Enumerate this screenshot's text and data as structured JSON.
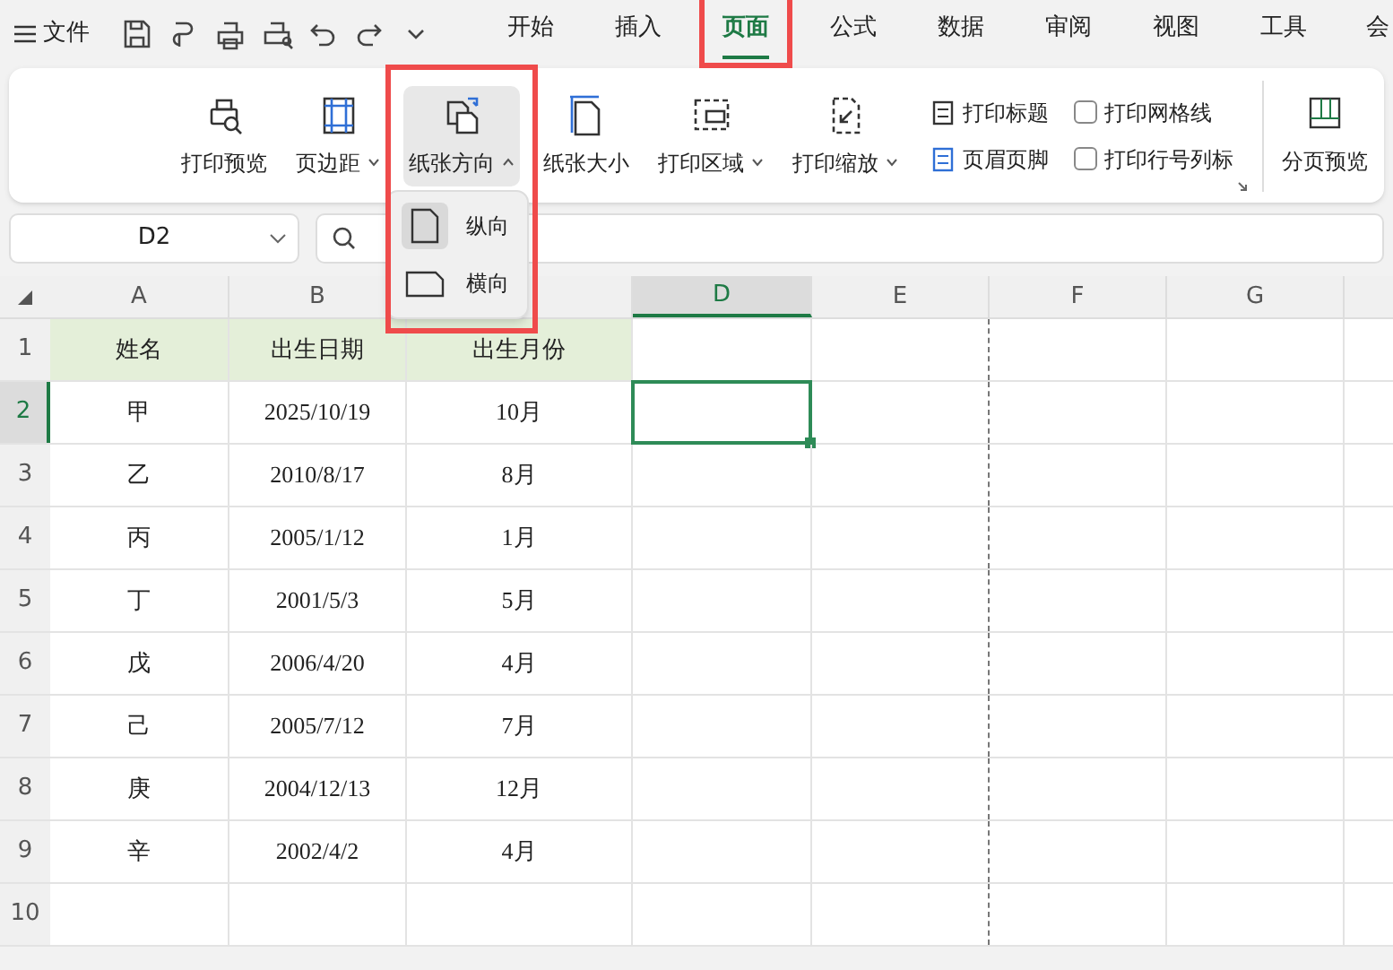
{
  "menu": {
    "label": "文件"
  },
  "tabs": [
    {
      "label": "开始",
      "selected": false,
      "highlighted": false
    },
    {
      "label": "插入",
      "selected": false,
      "highlighted": false
    },
    {
      "label": "页面",
      "selected": true,
      "highlighted": true
    },
    {
      "label": "公式",
      "selected": false,
      "highlighted": false
    },
    {
      "label": "数据",
      "selected": false,
      "highlighted": false
    },
    {
      "label": "审阅",
      "selected": false,
      "highlighted": false
    },
    {
      "label": "视图",
      "selected": false,
      "highlighted": false
    },
    {
      "label": "工具",
      "selected": false,
      "highlighted": false
    },
    {
      "label": "会",
      "selected": false,
      "highlighted": false
    }
  ],
  "ribbon": {
    "large_buttons": [
      {
        "kind": "preview",
        "label": "打印预览",
        "has_menu": false,
        "expanded": false,
        "highlighted": false
      },
      {
        "kind": "margins",
        "label": "页边距",
        "has_menu": true,
        "expanded": false,
        "highlighted": false
      },
      {
        "kind": "orientation",
        "label": "纸张方向",
        "has_menu": true,
        "expanded": true,
        "highlighted": true
      },
      {
        "kind": "size",
        "label": "纸张大小",
        "has_menu": false,
        "expanded": false,
        "highlighted": false
      },
      {
        "kind": "area",
        "label": "打印区域",
        "has_menu": true,
        "expanded": false,
        "highlighted": false
      },
      {
        "kind": "scale",
        "label": "打印缩放",
        "has_menu": true,
        "expanded": false,
        "highlighted": false
      }
    ],
    "small_buttons": [
      {
        "kind": "titles",
        "label": "打印标题"
      },
      {
        "kind": "header",
        "label": "页眉页脚"
      }
    ],
    "checkboxes": [
      {
        "label": "打印网格线",
        "checked": false
      },
      {
        "label": "打印行号列标",
        "checked": false
      }
    ],
    "page_break_preview": {
      "label": "分页预览"
    }
  },
  "orientation_menu": [
    {
      "kind": "portrait",
      "label": "纵向",
      "selected": true
    },
    {
      "kind": "landscape",
      "label": "横向",
      "selected": false
    }
  ],
  "name_box": {
    "value": "D2"
  },
  "sheet": {
    "columns": [
      {
        "label": "A",
        "selected": false
      },
      {
        "label": "B",
        "selected": false
      },
      {
        "selected": false
      },
      {
        "label": "D",
        "selected": true
      },
      {
        "label": "E",
        "selected": false
      },
      {
        "label": "F",
        "selected": false
      },
      {
        "label": "G",
        "selected": false
      }
    ],
    "header_row": {
      "label": "1",
      "cells": [
        "姓名",
        "出生日期",
        "出生月份"
      ]
    },
    "rows": [
      {
        "label": "2",
        "selected": true,
        "cells": [
          "甲",
          "2025/10/19",
          "10月"
        ]
      },
      {
        "label": "3",
        "selected": false,
        "cells": [
          "乙",
          "2010/8/17",
          "8月"
        ]
      },
      {
        "label": "4",
        "selected": false,
        "cells": [
          "丙",
          "2005/1/12",
          "1月"
        ]
      },
      {
        "label": "5",
        "selected": false,
        "cells": [
          "丁",
          "2001/5/3",
          "5月"
        ]
      },
      {
        "label": "6",
        "selected": false,
        "cells": [
          "戊",
          "2006/4/20",
          "4月"
        ]
      },
      {
        "label": "7",
        "selected": false,
        "cells": [
          "己",
          "2005/7/12",
          "7月"
        ]
      },
      {
        "label": "8",
        "selected": false,
        "cells": [
          "庚",
          "2004/12/13",
          "12月"
        ]
      },
      {
        "label": "9",
        "selected": false,
        "cells": [
          "辛",
          "2002/4/2",
          "4月"
        ]
      },
      {
        "label": "10",
        "selected": false,
        "cells": []
      }
    ]
  }
}
